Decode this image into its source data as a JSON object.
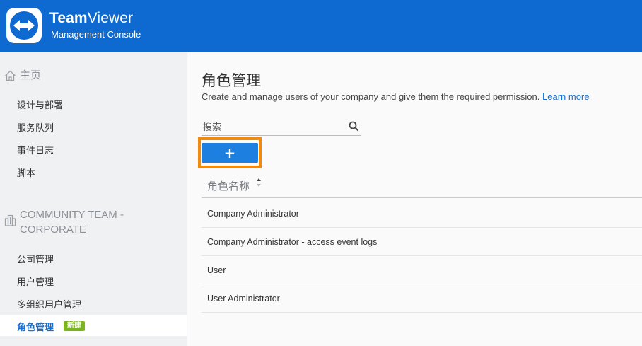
{
  "header": {
    "brand_bold": "Team",
    "brand_light": "Viewer",
    "brand_sub": "Management Console",
    "bg_color": "#0e6ad1"
  },
  "sidebar": {
    "home_label": "主页",
    "home_icon": "home-icon",
    "items": [
      {
        "label": "设计与部署"
      },
      {
        "label": "服务队列"
      },
      {
        "label": "事件日志"
      },
      {
        "label": "脚本"
      }
    ],
    "company_line1": "COMMUNITY TEAM -",
    "company_line2": "CORPORATE",
    "company_icon": "building-icon",
    "company_items": [
      {
        "label": "公司管理"
      },
      {
        "label": "用户管理"
      },
      {
        "label": "多组织用户管理"
      },
      {
        "label": "角色管理",
        "badge": "新建",
        "active": true
      }
    ]
  },
  "main": {
    "title": "角色管理",
    "description": "Create and manage users of your company and give them the required permission.",
    "learn_more": "Learn more",
    "search_placeholder": "搜索",
    "add_label": "+",
    "table": {
      "column_header": "角色名称",
      "rows": [
        "Company Administrator",
        "Company Administrator - access event logs",
        "User",
        "User Administrator"
      ]
    }
  },
  "colors": {
    "accent": "#1570d6",
    "highlight": "#f28a0f",
    "badge": "#7ab51d"
  }
}
